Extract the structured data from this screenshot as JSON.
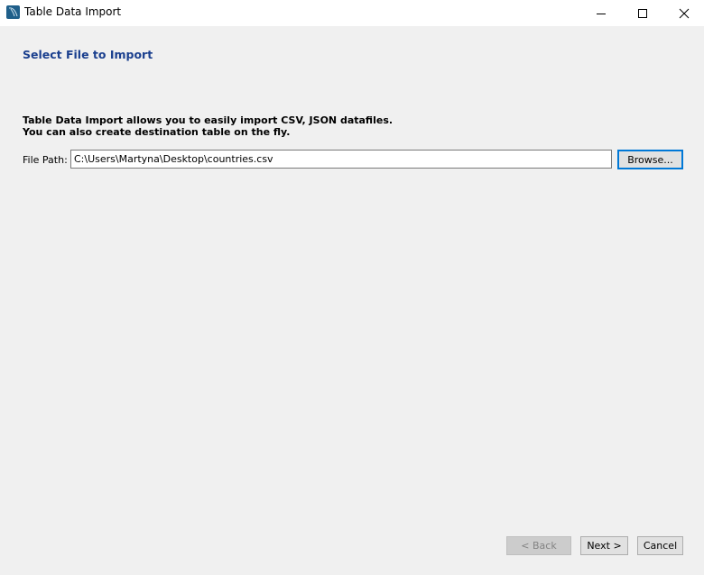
{
  "window": {
    "title": "Table Data Import",
    "icon": "mysql-workbench-dolphin-icon",
    "controls": {
      "minimize": "minimize-icon",
      "maximize": "maximize-icon",
      "close": "close-icon"
    }
  },
  "page": {
    "heading": "Select File to Import",
    "description_line1": "Table Data Import allows you to easily import CSV, JSON datafiles.",
    "description_line2": "You can also create destination table on the fly."
  },
  "file_path": {
    "label": "File Path:",
    "value": "C:\\Users\\Martyna\\Desktop\\countries.csv",
    "browse_label": "Browse..."
  },
  "footer": {
    "back_label": "< Back",
    "back_enabled": false,
    "next_label": "Next >",
    "cancel_label": "Cancel"
  },
  "colors": {
    "heading": "#1a3f8e",
    "focus_border": "#0078d7",
    "background": "#f0f0f0"
  }
}
